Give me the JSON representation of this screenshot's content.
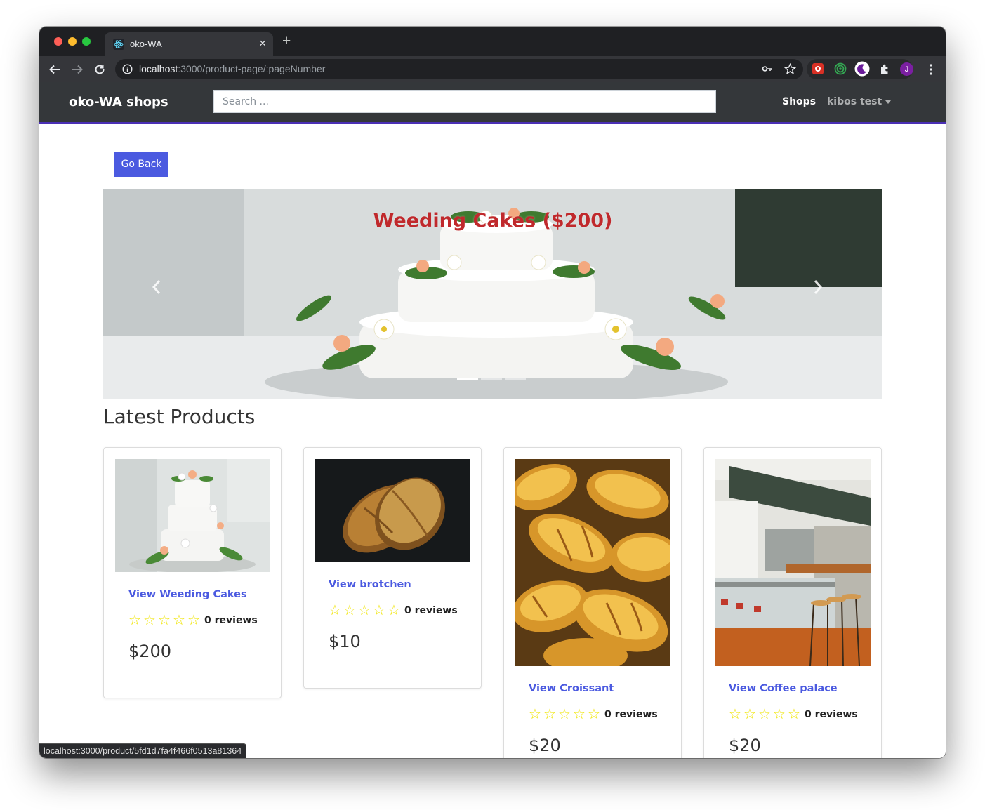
{
  "browser": {
    "tab_title": "oko-WA",
    "url_host": "localhost",
    "url_path": ":3000/product-page/:pageNumber",
    "status_url": "localhost:3000/product/5fd1d7fa4f466f0513a81364",
    "profile_initial": "J"
  },
  "navbar": {
    "brand": "oko-WA shops",
    "search_placeholder": "Search ...",
    "shops_label": "Shops",
    "user_label": "kibos test"
  },
  "go_back_label": "Go Back",
  "carousel": {
    "caption": "Weeding Cakes ($200)",
    "slide_count": 3,
    "active_index": 0
  },
  "section_title": "Latest Products",
  "products": [
    {
      "link": "View Weeding Cakes",
      "rating": 0,
      "reviews": "0 reviews",
      "price": "$200"
    },
    {
      "link": "View brotchen",
      "rating": 0,
      "reviews": "0 reviews",
      "price": "$10"
    },
    {
      "link": "View Croissant",
      "rating": 0,
      "reviews": "0 reviews",
      "price": "$20"
    },
    {
      "link": "View Coffee palace",
      "rating": 0,
      "reviews": "0 reviews",
      "price": "$20"
    }
  ],
  "colors": {
    "accent": "#4b5ae0",
    "navbar_bg": "#34373a",
    "caption": "#c0292c",
    "star": "#f0e500"
  }
}
